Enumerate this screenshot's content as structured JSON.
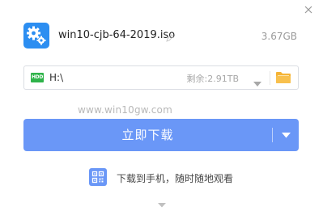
{
  "file": {
    "name": "win10-cjb-64-2019.iso",
    "size": "3.67GB"
  },
  "path": {
    "value": "H:\\",
    "drive_badge": "HDD",
    "free_space": "剩余:2.91TB"
  },
  "watermark": "www.win10gw.com",
  "download": {
    "label": "立即下载"
  },
  "qr": {
    "label": "下载到手机，随时随地观看"
  },
  "colors": {
    "accent": "#6a97f7",
    "file_icon": "#2c8ef1",
    "hdd": "#2fb34a",
    "folder": "#f5b335"
  },
  "icons": {
    "close": "close-icon",
    "file": "gear-settings-icon",
    "edit": "edit-icon",
    "hdd": "hdd-icon",
    "dropdown": "chevron-down-icon",
    "folder": "folder-icon",
    "qr": "qr-code-icon",
    "expand": "expand-arrow-icon"
  }
}
